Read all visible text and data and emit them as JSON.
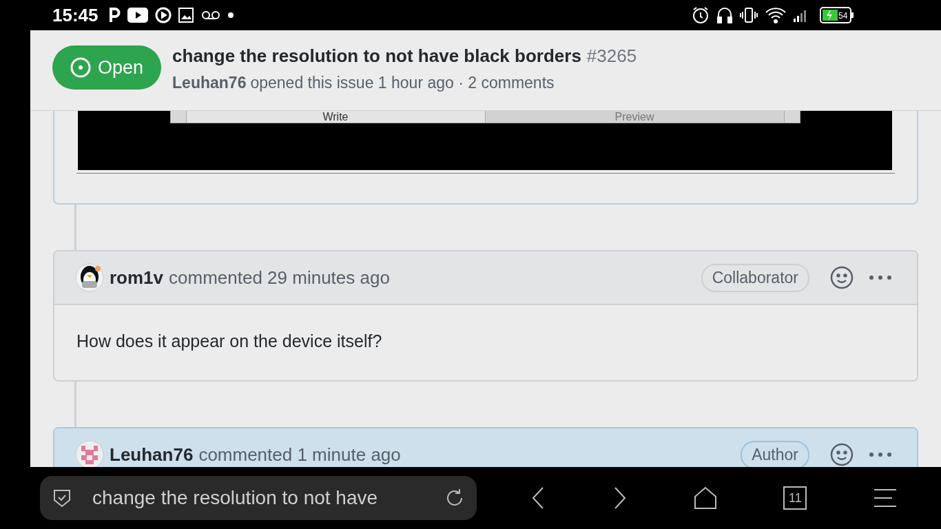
{
  "status_bar": {
    "time": "15:45",
    "battery": "54"
  },
  "issue": {
    "state": "Open",
    "title": "change the resolution to not have black borders",
    "number": "#3265",
    "author": "Leuhan76",
    "meta": "opened this issue 1 hour ago · 2 comments"
  },
  "attachment": {
    "tabs": [
      {
        "label": "Write",
        "selected": true
      },
      {
        "label": "Preview",
        "selected": false
      }
    ]
  },
  "comments": [
    {
      "author": "rom1v",
      "action": "commented 29 minutes ago",
      "badge": "Collaborator",
      "highlighted": false,
      "avatar": {
        "kind": "penguin"
      },
      "body": "How does it appear on the device itself?"
    },
    {
      "author": "Leuhan76",
      "action": "commented 1 minute ago",
      "badge": "Author",
      "highlighted": true,
      "avatar": {
        "kind": "identicon"
      }
    }
  ],
  "browser": {
    "url": "change the resolution to not have",
    "tab_count": "11"
  }
}
